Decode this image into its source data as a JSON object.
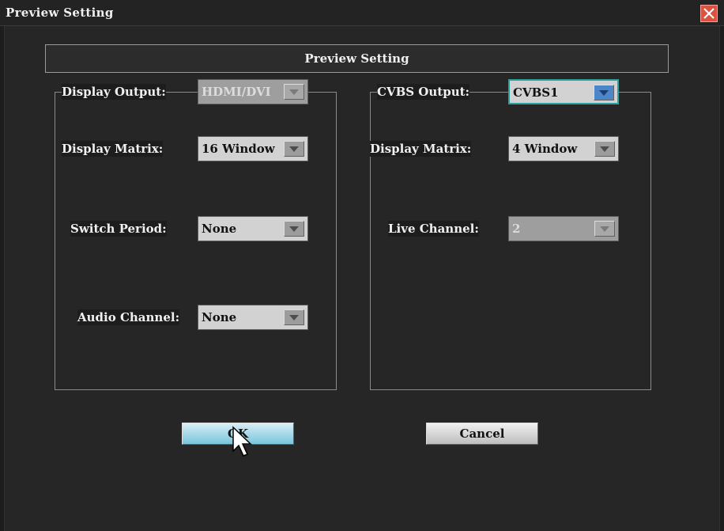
{
  "window": {
    "title": "Preview Setting",
    "close_icon": "close-icon"
  },
  "header": {
    "title": "Preview Setting"
  },
  "left_group": {
    "display_output": {
      "label": "Display Output:",
      "value": "HDMI/DVI",
      "enabled": false
    },
    "display_matrix": {
      "label": "Display Matrix:",
      "value": "16 Window"
    },
    "switch_period": {
      "label": "Switch Period:",
      "value": "None"
    },
    "audio_channel": {
      "label": "Audio Channel:",
      "value": "None"
    }
  },
  "right_group": {
    "cvbs_output": {
      "label": "CVBS Output:",
      "value": "CVBS1",
      "focused": true
    },
    "display_matrix": {
      "label": "Display Matrix:",
      "value": "4 Window"
    },
    "live_channel": {
      "label": "Live Channel:",
      "value": "2",
      "enabled": false
    }
  },
  "buttons": {
    "ok_label": "OK",
    "cancel_label": "Cancel"
  },
  "colors": {
    "ok_button": "#79c5dd",
    "close_button": "#e05040",
    "focus_border": "#2aa0a0"
  }
}
